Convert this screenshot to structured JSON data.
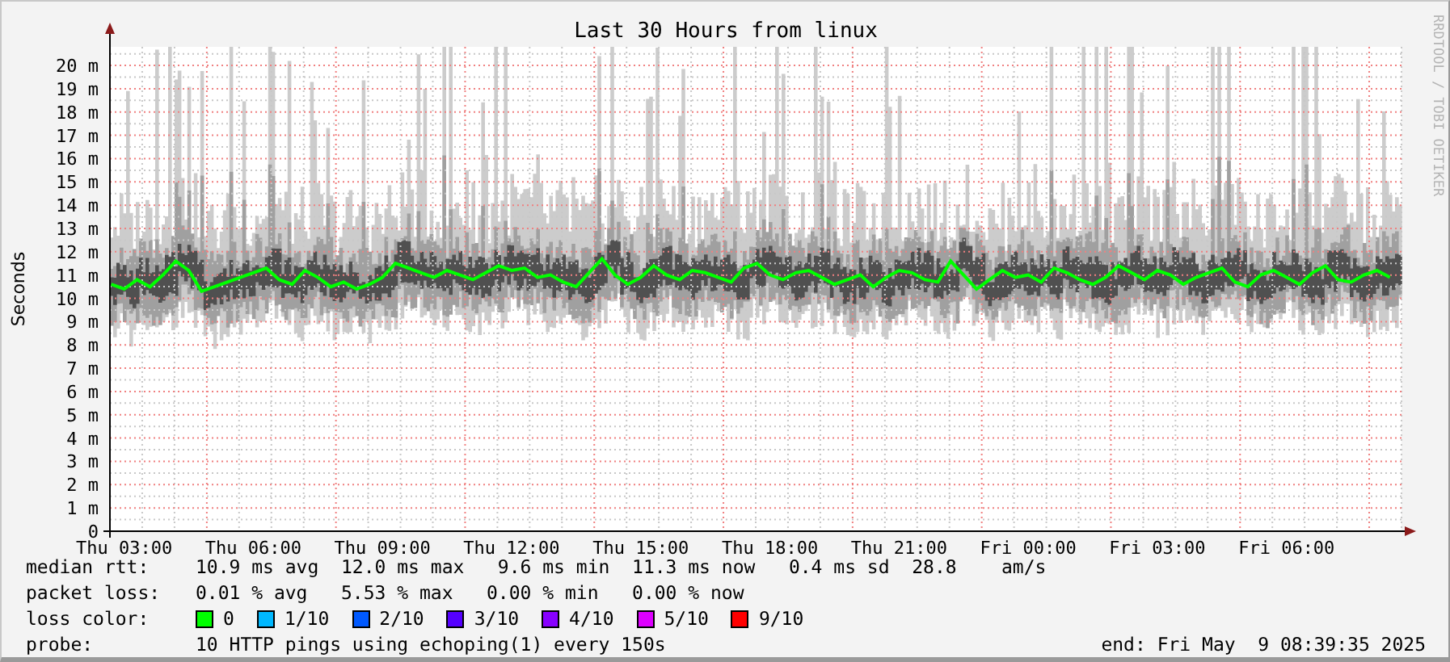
{
  "graph": {
    "watermark": "RRDTOOL / TOBI OETIKER",
    "chart_data": {
      "type": "line",
      "title": "Last 30 Hours from linux",
      "ylabel": "Seconds",
      "grid": true,
      "ylim": [
        0,
        20.8
      ],
      "yticks": [
        {
          "value": 0,
          "label": "0"
        },
        {
          "value": 1,
          "label": "1 m"
        },
        {
          "value": 2,
          "label": "2 m"
        },
        {
          "value": 3,
          "label": "3 m"
        },
        {
          "value": 4,
          "label": "4 m"
        },
        {
          "value": 5,
          "label": "5 m"
        },
        {
          "value": 6,
          "label": "6 m"
        },
        {
          "value": 7,
          "label": "7 m"
        },
        {
          "value": 8,
          "label": "8 m"
        },
        {
          "value": 9,
          "label": "9 m"
        },
        {
          "value": 10,
          "label": "10 m"
        },
        {
          "value": 11,
          "label": "11 m"
        },
        {
          "value": 12,
          "label": "12 m"
        },
        {
          "value": 13,
          "label": "13 m"
        },
        {
          "value": 14,
          "label": "14 m"
        },
        {
          "value": 15,
          "label": "15 m"
        },
        {
          "value": 16,
          "label": "16 m"
        },
        {
          "value": 17,
          "label": "17 m"
        },
        {
          "value": 18,
          "label": "18 m"
        },
        {
          "value": 19,
          "label": "19 m"
        },
        {
          "value": 20,
          "label": "20 m"
        }
      ],
      "categories": [
        null,
        "Thu 03:00",
        null,
        null,
        null,
        null,
        null,
        null,
        null,
        null,
        null,
        "Thu 06:00",
        null,
        null,
        null,
        null,
        null,
        null,
        null,
        null,
        null,
        "Thu 09:00",
        null,
        null,
        null,
        null,
        null,
        null,
        null,
        null,
        null,
        "Thu 12:00",
        null,
        null,
        null,
        null,
        null,
        null,
        null,
        null,
        null,
        "Thu 15:00",
        null,
        null,
        null,
        null,
        null,
        null,
        null,
        null,
        null,
        "Thu 18:00",
        null,
        null,
        null,
        null,
        null,
        null,
        null,
        null,
        null,
        "Thu 21:00",
        null,
        null,
        null,
        null,
        null,
        null,
        null,
        null,
        null,
        "Fri 00:00",
        null,
        null,
        null,
        null,
        null,
        null,
        null,
        null,
        null,
        "Fri 03:00",
        null,
        null,
        null,
        null,
        null,
        null,
        null,
        null,
        null,
        "Fri 06:00",
        null,
        null,
        null,
        null,
        null,
        null,
        null,
        null
      ],
      "series": [
        {
          "name": "median rtt:",
          "color": "#00ff00",
          "values": [
            10.6,
            10.4,
            10.8,
            10.5,
            11.0,
            11.6,
            11.2,
            10.3,
            10.5,
            10.7,
            10.9,
            11.1,
            11.3,
            10.8,
            10.6,
            11.2,
            10.9,
            10.5,
            10.7,
            10.4,
            10.6,
            10.9,
            11.5,
            11.3,
            11.1,
            10.9,
            11.2,
            11.0,
            10.8,
            11.1,
            11.4,
            11.2,
            11.3,
            10.9,
            11.0,
            10.7,
            10.5,
            11.1,
            11.7,
            11.0,
            10.6,
            10.9,
            11.4,
            11.0,
            10.8,
            11.2,
            11.1,
            10.9,
            10.7,
            11.3,
            11.5,
            11.0,
            10.8,
            11.1,
            11.2,
            10.9,
            10.6,
            10.8,
            11.0,
            10.5,
            10.9,
            11.2,
            11.1,
            10.8,
            10.7,
            11.6,
            11.0,
            10.4,
            10.8,
            11.2,
            10.9,
            11.0,
            10.7,
            11.3,
            11.1,
            10.8,
            10.6,
            10.9,
            11.4,
            11.1,
            10.8,
            11.2,
            11.0,
            10.6,
            10.9,
            11.1,
            11.3,
            10.7,
            10.5,
            11.0,
            11.2,
            10.9,
            10.6,
            11.1,
            11.4,
            10.8,
            10.7,
            11.0,
            11.2,
            10.9
          ]
        }
      ]
    }
  },
  "legend": {
    "median_rtt": {
      "text": "10.9 ms avg  12.0 ms max   9.6 ms min  11.3 ms now   0.4 ms sd  28.8    am/s"
    },
    "packet_loss": {
      "label": "packet loss:",
      "text": "0.01 % avg   5.53 % max   0.00 % min   0.00 % now"
    },
    "loss_color": {
      "label": "loss color:",
      "items": [
        {
          "label": "0",
          "color": "#00ff00"
        },
        {
          "label": "1/10",
          "color": "#00b8ff"
        },
        {
          "label": "2/10",
          "color": "#0059ff"
        },
        {
          "label": "3/10",
          "color": "#5500ff"
        },
        {
          "label": "4/10",
          "color": "#8800ff"
        },
        {
          "label": "5/10",
          "color": "#dd00ff"
        },
        {
          "label": "9/10",
          "color": "#ff0000"
        }
      ]
    },
    "probe": {
      "label": "probe:",
      "text": "10 HTTP pings using echoping(1) every 150s"
    },
    "end": "end: Fri May  9 08:39:35 2025"
  }
}
